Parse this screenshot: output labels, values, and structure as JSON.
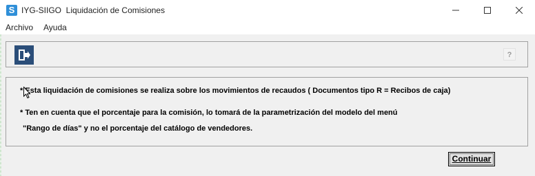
{
  "window": {
    "app_icon": "S",
    "title": "IYG-SIIGO  Liquidación de Comisiones",
    "controls": [
      "minimize-icon",
      "maximize-icon",
      "close-icon"
    ]
  },
  "menu": {
    "items": [
      {
        "label": "Archivo"
      },
      {
        "label": "Ayuda"
      }
    ]
  },
  "toolbar": {
    "exit_icon": "exit-door-icon",
    "help_label": "?"
  },
  "info": {
    "line1": "* Esta liquidación de comisiones se realiza sobre los movimientos de recaudos ( Documentos tipo R = Recibos de caja)",
    "line2": "* Ten en cuenta que el porcentaje para la comisión, lo tomará de la parametrización del modelo del menú",
    "line3": "\"Rango de días\" y no el porcentaje del catálogo de vendedores."
  },
  "actions": {
    "continue_label": "Continuar"
  },
  "colors": {
    "exit_button_bg": "#2b4e79",
    "app_icon_bg": "#2f8fd8",
    "window_bg": "#f0f0f0"
  }
}
